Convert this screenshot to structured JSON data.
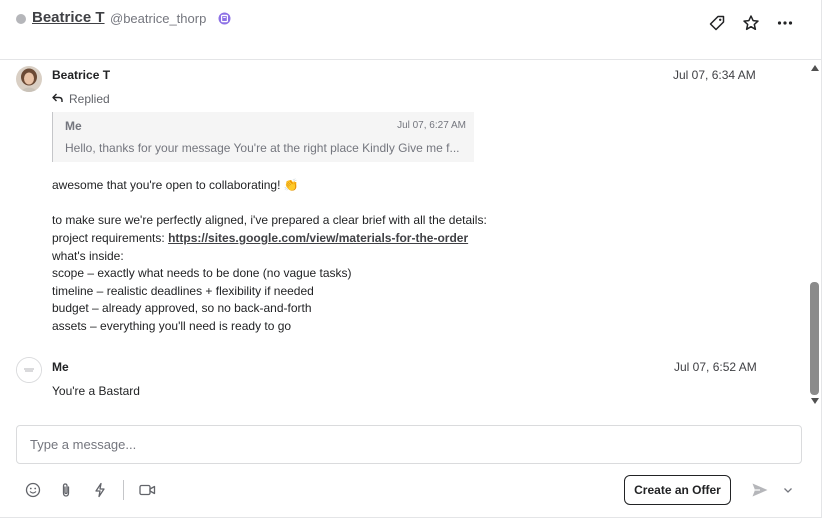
{
  "header": {
    "contact_name": "Beatrice T",
    "contact_handle": "@beatrice_thorp",
    "status_color": "#b5b6ba",
    "icons": [
      "tag-icon",
      "star-icon",
      "more-icon"
    ]
  },
  "messages": [
    {
      "sender": "Beatrice T",
      "time": "Jul 07, 6:34 AM",
      "replied_label": "Replied",
      "quote": {
        "sender": "Me",
        "time": "Jul 07, 6:27 AM",
        "text": "Hello, thanks for your message You're at the right place Kindly Give me f..."
      },
      "lines": {
        "l1": "awesome that you're open to collaborating! 👏",
        "l2": "to make sure we're perfectly aligned, i've prepared a clear brief with all the details:",
        "l3_prefix": "project requirements: ",
        "l3_link": "https://sites.google.com/view/materials-for-the-order",
        "l4": "what's inside:",
        "l5": "scope – exactly what needs to be done (no vague tasks)",
        "l6": "timeline – realistic deadlines + flexibility if needed",
        "l7": "budget – already approved, so no back-and-forth",
        "l8": "assets – everything you'll need is ready to go"
      }
    },
    {
      "sender": "Me",
      "time": "Jul 07, 6:52 AM",
      "text": "You're a Bastard"
    }
  ],
  "composer": {
    "placeholder": "Type a message...",
    "offer_label": "Create an Offer",
    "tools": [
      "emoji-icon",
      "attachment-icon",
      "quick-response-icon",
      "video-call-icon"
    ]
  },
  "colors": {
    "accent_text": "#222325",
    "muted_text": "#74767e",
    "verified_badge": "#8e72e6"
  }
}
